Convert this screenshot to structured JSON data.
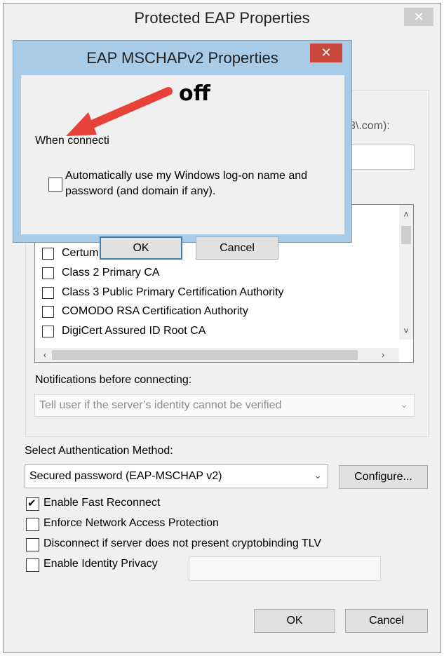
{
  "outer": {
    "title": "Protected EAP Properties",
    "close_glyph": "✕",
    "partial_text_right": "3\\.com):",
    "cert_list": [
      {
        "label": "Certum CA",
        "checked": false
      },
      {
        "label": "Class 2 Primary CA",
        "checked": false
      },
      {
        "label": "Class 3 Public Primary Certification Authority",
        "checked": false
      },
      {
        "label": "COMODO RSA Certification Authority",
        "checked": false
      },
      {
        "label": "DigiCert Assured ID Root CA",
        "checked": false
      }
    ],
    "notifications_label": "Notifications before connecting:",
    "notifications_value": "Tell user if the server’s identity cannot be verified",
    "auth_method_label": "Select Authentication Method:",
    "auth_method_value": "Secured password (EAP-MSCHAP v2)",
    "configure_label": "Configure...",
    "options": [
      {
        "label": "Enable Fast Reconnect",
        "checked": true
      },
      {
        "label": "Enforce Network Access Protection",
        "checked": false
      },
      {
        "label": "Disconnect if server does not present cryptobinding TLV",
        "checked": false
      },
      {
        "label": "Enable Identity Privacy",
        "checked": false
      }
    ],
    "ok_label": "OK",
    "cancel_label": "Cancel"
  },
  "inner": {
    "title": "EAP MSCHAPv2 Properties",
    "close_glyph": "✕",
    "when_connecting_text": "When connecti",
    "auto_logon_line1": "Automatically use my Windows log-on name and",
    "auto_logon_line2": "password (and domain if any).",
    "auto_logon_checked": false,
    "ok_label": "OK",
    "cancel_label": "Cancel"
  },
  "annotation": {
    "text": "off",
    "arrow_color": "#e8413a"
  }
}
